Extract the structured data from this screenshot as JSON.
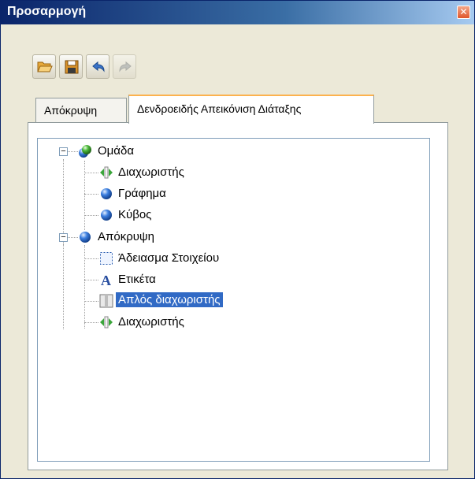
{
  "window": {
    "title": "Προσαρμογή"
  },
  "toolbar": {
    "buttons": [
      {
        "icon": "open-folder-icon",
        "enabled": true
      },
      {
        "icon": "save-icon",
        "enabled": true
      },
      {
        "icon": "undo-icon",
        "enabled": true
      },
      {
        "icon": "redo-icon",
        "enabled": false
      }
    ]
  },
  "tabs": [
    {
      "label": "Απόκρυψη",
      "active": false
    },
    {
      "label": "Δενδροειδής Απεικόνιση Διάταξης",
      "active": true
    }
  ],
  "tree": {
    "groups": [
      {
        "label": "Ομάδα",
        "icon": "green-sphere-icon",
        "expanded": true,
        "children": [
          {
            "label": "Διαχωριστής",
            "icon": "splitter-icon"
          },
          {
            "label": "Γράφημα",
            "icon": "blue-sphere-icon"
          },
          {
            "label": "Κύβος",
            "icon": "blue-sphere-icon"
          }
        ]
      },
      {
        "label": "Απόκρυψη",
        "icon": "blue-sphere-icon",
        "expanded": true,
        "children": [
          {
            "label": "Άδειασμα Στοιχείου",
            "icon": "empty-space-icon"
          },
          {
            "label": "Ετικέτα",
            "icon": "label-a-icon"
          },
          {
            "label": "Απλός διαχωριστής",
            "icon": "simple-separator-icon",
            "selected": true
          },
          {
            "label": "Διαχωριστής",
            "icon": "splitter-icon"
          }
        ]
      }
    ]
  },
  "colors": {
    "selection": "#316ac5",
    "titlebar": "#0a246a",
    "dialog_bg": "#ece9d8"
  }
}
